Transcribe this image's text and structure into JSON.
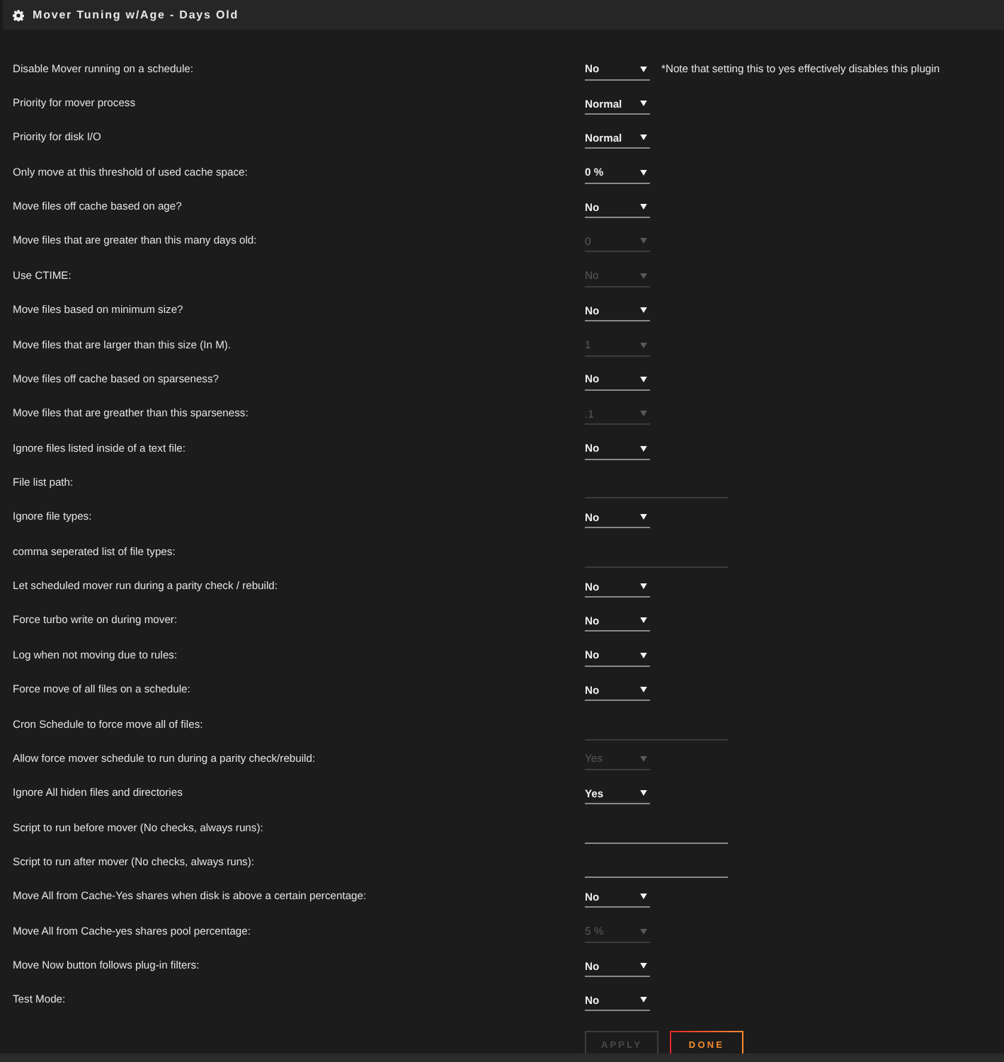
{
  "panel": {
    "title": "Mover Tuning w/Age - Days Old"
  },
  "settings": [
    {
      "label": "Disable Mover running on a schedule:",
      "kind": "select",
      "value": "No",
      "disabled": false,
      "note": "*Note that setting this to yes effectively disables this plugin"
    },
    {
      "label": "Priority for mover process",
      "kind": "select",
      "value": "Normal",
      "disabled": false
    },
    {
      "label": "Priority for disk I/O",
      "kind": "select",
      "value": "Normal",
      "disabled": false
    },
    {
      "label": "Only move at this threshold of used cache space:",
      "kind": "select",
      "value": "0 %",
      "disabled": false
    },
    {
      "label": "Move files off cache based on age?",
      "kind": "select",
      "value": "No",
      "disabled": false
    },
    {
      "label": "Move files that are greater than this many days old:",
      "kind": "select",
      "value": "0",
      "disabled": true
    },
    {
      "label": "Use CTIME:",
      "kind": "select",
      "value": "No",
      "disabled": true
    },
    {
      "label": "Move files based on minimum size?",
      "kind": "select",
      "value": "No",
      "disabled": false
    },
    {
      "label": "Move files that are larger than this size (In M).",
      "kind": "select",
      "value": "1",
      "disabled": true
    },
    {
      "label": "Move files off cache based on sparseness?",
      "kind": "select",
      "value": "No",
      "disabled": false
    },
    {
      "label": "Move files that are greather than this sparseness:",
      "kind": "select",
      "value": ".1",
      "disabled": true
    },
    {
      "label": "Ignore files listed inside of a text file:",
      "kind": "select",
      "value": "No",
      "disabled": false
    },
    {
      "label": "File list path:",
      "kind": "text",
      "disabled": true
    },
    {
      "label": "Ignore file types:",
      "kind": "select",
      "value": "No",
      "disabled": false
    },
    {
      "label": "comma seperated list of file types:",
      "kind": "text",
      "disabled": true
    },
    {
      "label": "Let scheduled mover run during a parity check / rebuild:",
      "kind": "select",
      "value": "No",
      "disabled": false
    },
    {
      "label": "Force turbo write on during mover:",
      "kind": "select",
      "value": "No",
      "disabled": false
    },
    {
      "label": "Log when not moving due to rules:",
      "kind": "select",
      "value": "No",
      "disabled": false
    },
    {
      "label": "Force move of all files on a schedule:",
      "kind": "select",
      "value": "No",
      "disabled": false
    },
    {
      "label": "Cron Schedule to force move all of files:",
      "kind": "text",
      "disabled": true
    },
    {
      "label": "Allow force mover schedule to run during a parity check/rebuild:",
      "kind": "select",
      "value": "Yes",
      "disabled": true
    },
    {
      "label": "Ignore All hiden files and directories",
      "kind": "select",
      "value": "Yes",
      "disabled": false
    },
    {
      "label": "Script to run before mover (No checks, always runs):",
      "kind": "text",
      "disabled": false
    },
    {
      "label": "Script to run after mover (No checks, always runs):",
      "kind": "text",
      "disabled": false
    },
    {
      "label": "Move All from Cache-Yes shares when disk is above a certain percentage:",
      "kind": "select",
      "value": "No",
      "disabled": false
    },
    {
      "label": "Move All from Cache-yes shares pool percentage:",
      "kind": "select",
      "value": "5 %",
      "disabled": true
    },
    {
      "label": "Move Now button follows plug-in filters:",
      "kind": "select",
      "value": "No",
      "disabled": false
    },
    {
      "label": "Test Mode:",
      "kind": "select",
      "value": "No",
      "disabled": false
    }
  ],
  "buttons": [
    {
      "label": "APPLY",
      "disabled": true
    },
    {
      "label": "DONE",
      "disabled": false
    }
  ]
}
